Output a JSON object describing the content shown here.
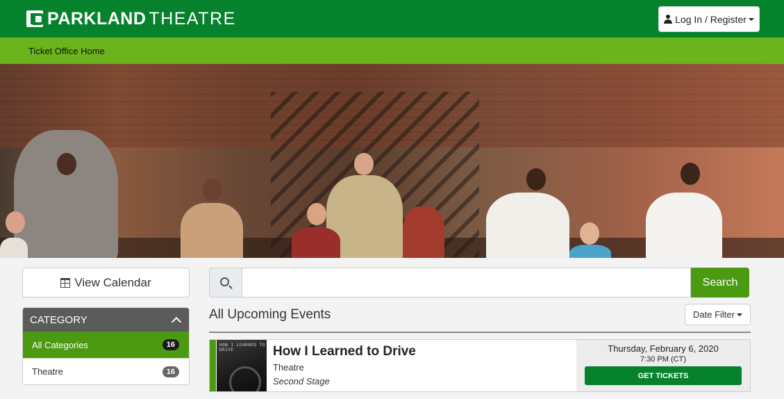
{
  "header": {
    "logo_bold": "PARKLAND",
    "logo_light": "THEATRE",
    "login_label": "Log In / Register",
    "brand_color": "#06822d"
  },
  "subnav": {
    "home_link": "Ticket Office Home",
    "color": "#6cb41e"
  },
  "sidebar": {
    "calendar_button": "View Calendar",
    "category_header": "CATEGORY",
    "categories": [
      {
        "label": "All Categories",
        "count": "16",
        "active": true
      },
      {
        "label": "Theatre",
        "count": "16",
        "active": false
      }
    ]
  },
  "search": {
    "value": "",
    "placeholder": "",
    "button": "Search"
  },
  "events": {
    "heading": "All Upcoming Events",
    "date_filter": "Date Filter",
    "items": [
      {
        "title": "How I Learned to Drive",
        "category": "Theatre",
        "venue": "Second Stage",
        "date": "Thursday, February 6, 2020",
        "time": "7:30 PM (CT)",
        "button": "GET TICKETS",
        "poster_text": "HOW I LEARNED TO DRIVE"
      }
    ]
  },
  "icons": [
    "user-icon",
    "calendar-icon",
    "search-icon",
    "chevron-up-icon",
    "caret-down-icon"
  ]
}
